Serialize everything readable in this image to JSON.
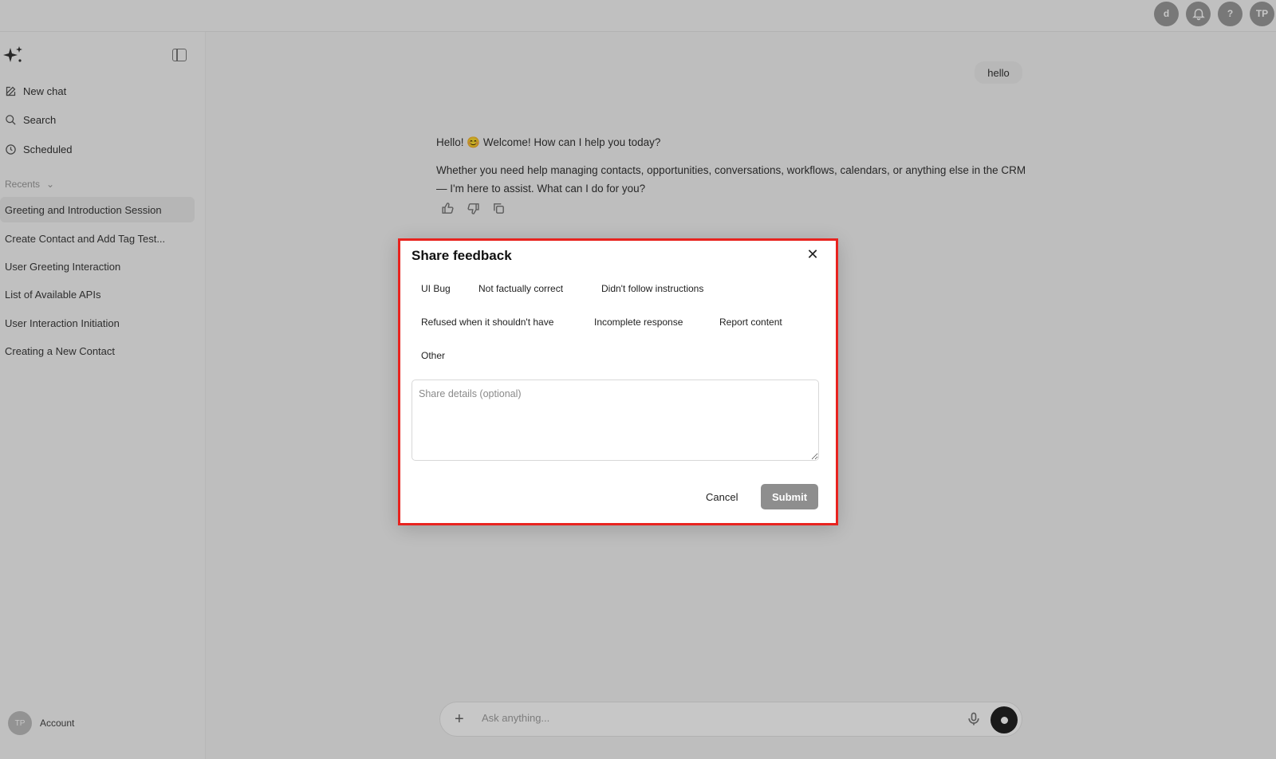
{
  "topbar": {
    "icons": [
      {
        "name": "app-badge-icon",
        "text": "d"
      },
      {
        "name": "notifications-icon",
        "text": ""
      },
      {
        "name": "help-icon",
        "text": "?"
      },
      {
        "name": "profile-avatar-icon",
        "text": "TP"
      }
    ]
  },
  "sidebar": {
    "nav": [
      {
        "label": "New chat",
        "icon": "edit-icon"
      },
      {
        "label": "Search",
        "icon": "search-icon"
      },
      {
        "label": "Scheduled",
        "icon": "clock-icon"
      }
    ],
    "recents_label": "Recents",
    "recents": [
      "Greeting and Introduction Session",
      "Create Contact and Add Tag Test...",
      "User Greeting Interaction",
      "List of Available APIs",
      "User Interaction Initiation",
      "Creating a New Contact"
    ],
    "account": {
      "initials": "TP",
      "label": "Account"
    }
  },
  "chat": {
    "user_message": "hello",
    "assistant_line1": "Hello! 😊 Welcome! How can I help you today?",
    "assistant_line2": "Whether you need help managing contacts, opportunities, conversations, workflows, calendars, or anything else in the CRM — I'm here to assist. What can I do for you?",
    "composer_placeholder": "Ask anything..."
  },
  "modal": {
    "title": "Share feedback",
    "close_symbol": "✕",
    "chips": [
      "UI Bug",
      "Not factually correct",
      "Didn't follow instructions",
      "Refused when it shouldn't have",
      "Incomplete response",
      "Report content",
      "Other"
    ],
    "details_placeholder": "Share details (optional)",
    "cancel_label": "Cancel",
    "submit_label": "Submit"
  },
  "colors": {
    "highlight": "#e8231f",
    "submit_bg": "#8e8e8e"
  }
}
